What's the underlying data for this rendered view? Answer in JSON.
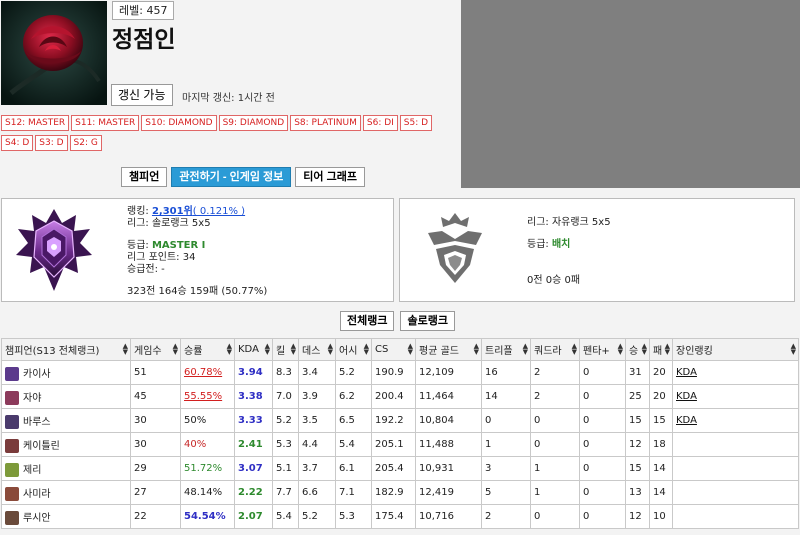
{
  "profile": {
    "level": "레벨: 457",
    "name": "정점인",
    "update_label": "갱신 가능",
    "last_update": "마지막 갱신: 1시간 전",
    "avatar_icon": "rose-icon",
    "history": [
      "S12: MASTER",
      "S11: MASTER",
      "S10: DIAMOND",
      "S9: DIAMOND",
      "S8: PLATINUM",
      "S6: DI",
      "S5: D",
      "S4: D",
      "S3: D",
      "S2: G"
    ]
  },
  "tabs": [
    "챔피언",
    "관전하기 - 인게임 정보",
    "티어 그래프"
  ],
  "solo": {
    "rank_prefix": "랭킹: ",
    "rank": "2,301위",
    "rank_pct": "( 0.121% )",
    "league": "리그: 솔로랭크 5x5",
    "tier_prefix": "등급: ",
    "tier": "MASTER I",
    "points": "리그 포인트: 34",
    "promo": "승급전: -",
    "record": "323전 164승 159패 (50.77%)",
    "emblem_icon": "master-emblem-icon"
  },
  "flex": {
    "league": "리그: 자유랭크 5x5",
    "tier_prefix": "등급: ",
    "tier": "배치",
    "record": "0전 0승 0패",
    "emblem_icon": "unranked-emblem-icon"
  },
  "sort_buttons": [
    "전체랭크",
    "솔로랭크"
  ],
  "table": {
    "headers": [
      "챔피언(S13 전체랭크)",
      "게임수",
      "승률",
      "KDA",
      "킬",
      "데스",
      "어시",
      "CS",
      "평균 골드",
      "트리플",
      "쿼드라",
      "펜타+",
      "승",
      "패",
      "장인랭킹"
    ],
    "rows": [
      {
        "champion": "카이사",
        "games": "51",
        "winrate": "60.78%",
        "kda": "3.94",
        "kills": "8.3",
        "deaths": "3.4",
        "assists": "5.2",
        "cs": "190.9",
        "gold": "12,109",
        "triple": "16",
        "quadra": "2",
        "penta": "0",
        "wins": "31",
        "losses": "20",
        "mastery": "KDA",
        "wr_style": "red",
        "kda_style": "blue",
        "icon_color": "#5b3a8c"
      },
      {
        "champion": "자야",
        "games": "45",
        "winrate": "55.55%",
        "kda": "3.38",
        "kills": "7.0",
        "deaths": "3.9",
        "assists": "6.2",
        "cs": "200.4",
        "gold": "11,464",
        "triple": "14",
        "quadra": "2",
        "penta": "0",
        "wins": "25",
        "losses": "20",
        "mastery": "KDA",
        "wr_style": "red",
        "kda_style": "blue",
        "icon_color": "#8c3a5b"
      },
      {
        "champion": "바루스",
        "games": "30",
        "winrate": "50%",
        "kda": "3.33",
        "kills": "5.2",
        "deaths": "3.5",
        "assists": "6.5",
        "cs": "192.2",
        "gold": "10,804",
        "triple": "0",
        "quadra": "0",
        "penta": "0",
        "wins": "15",
        "losses": "15",
        "mastery": "KDA",
        "wr_style": "black",
        "kda_style": "blue",
        "icon_color": "#4a3a6c"
      },
      {
        "champion": "케이틀린",
        "games": "30",
        "winrate": "40%",
        "kda": "2.41",
        "kills": "5.3",
        "deaths": "4.4",
        "assists": "5.4",
        "cs": "205.1",
        "gold": "11,488",
        "triple": "1",
        "quadra": "0",
        "penta": "0",
        "wins": "12",
        "losses": "18",
        "mastery": "",
        "wr_style": "redplain",
        "kda_style": "green",
        "icon_color": "#7a3b3b"
      },
      {
        "champion": "제리",
        "games": "29",
        "winrate": "51.72%",
        "kda": "3.07",
        "kills": "5.1",
        "deaths": "3.7",
        "assists": "6.1",
        "cs": "205.4",
        "gold": "10,931",
        "triple": "3",
        "quadra": "1",
        "penta": "0",
        "wins": "15",
        "losses": "14",
        "mastery": "",
        "wr_style": "green",
        "kda_style": "blue",
        "icon_color": "#7d9a3a"
      },
      {
        "champion": "사미라",
        "games": "27",
        "winrate": "48.14%",
        "kda": "2.22",
        "kills": "7.7",
        "deaths": "6.6",
        "assists": "7.1",
        "cs": "182.9",
        "gold": "12,419",
        "triple": "5",
        "quadra": "1",
        "penta": "0",
        "wins": "13",
        "losses": "14",
        "mastery": "",
        "wr_style": "black",
        "kda_style": "green",
        "icon_color": "#8a4a3a"
      },
      {
        "champion": "루시안",
        "games": "22",
        "winrate": "54.54%",
        "kda": "2.07",
        "kills": "5.4",
        "deaths": "5.2",
        "assists": "5.3",
        "cs": "175.4",
        "gold": "10,716",
        "triple": "2",
        "quadra": "0",
        "penta": "0",
        "wins": "12",
        "losses": "10",
        "mastery": "",
        "wr_style": "blue",
        "kda_style": "green",
        "icon_color": "#6a4a3a"
      }
    ]
  }
}
